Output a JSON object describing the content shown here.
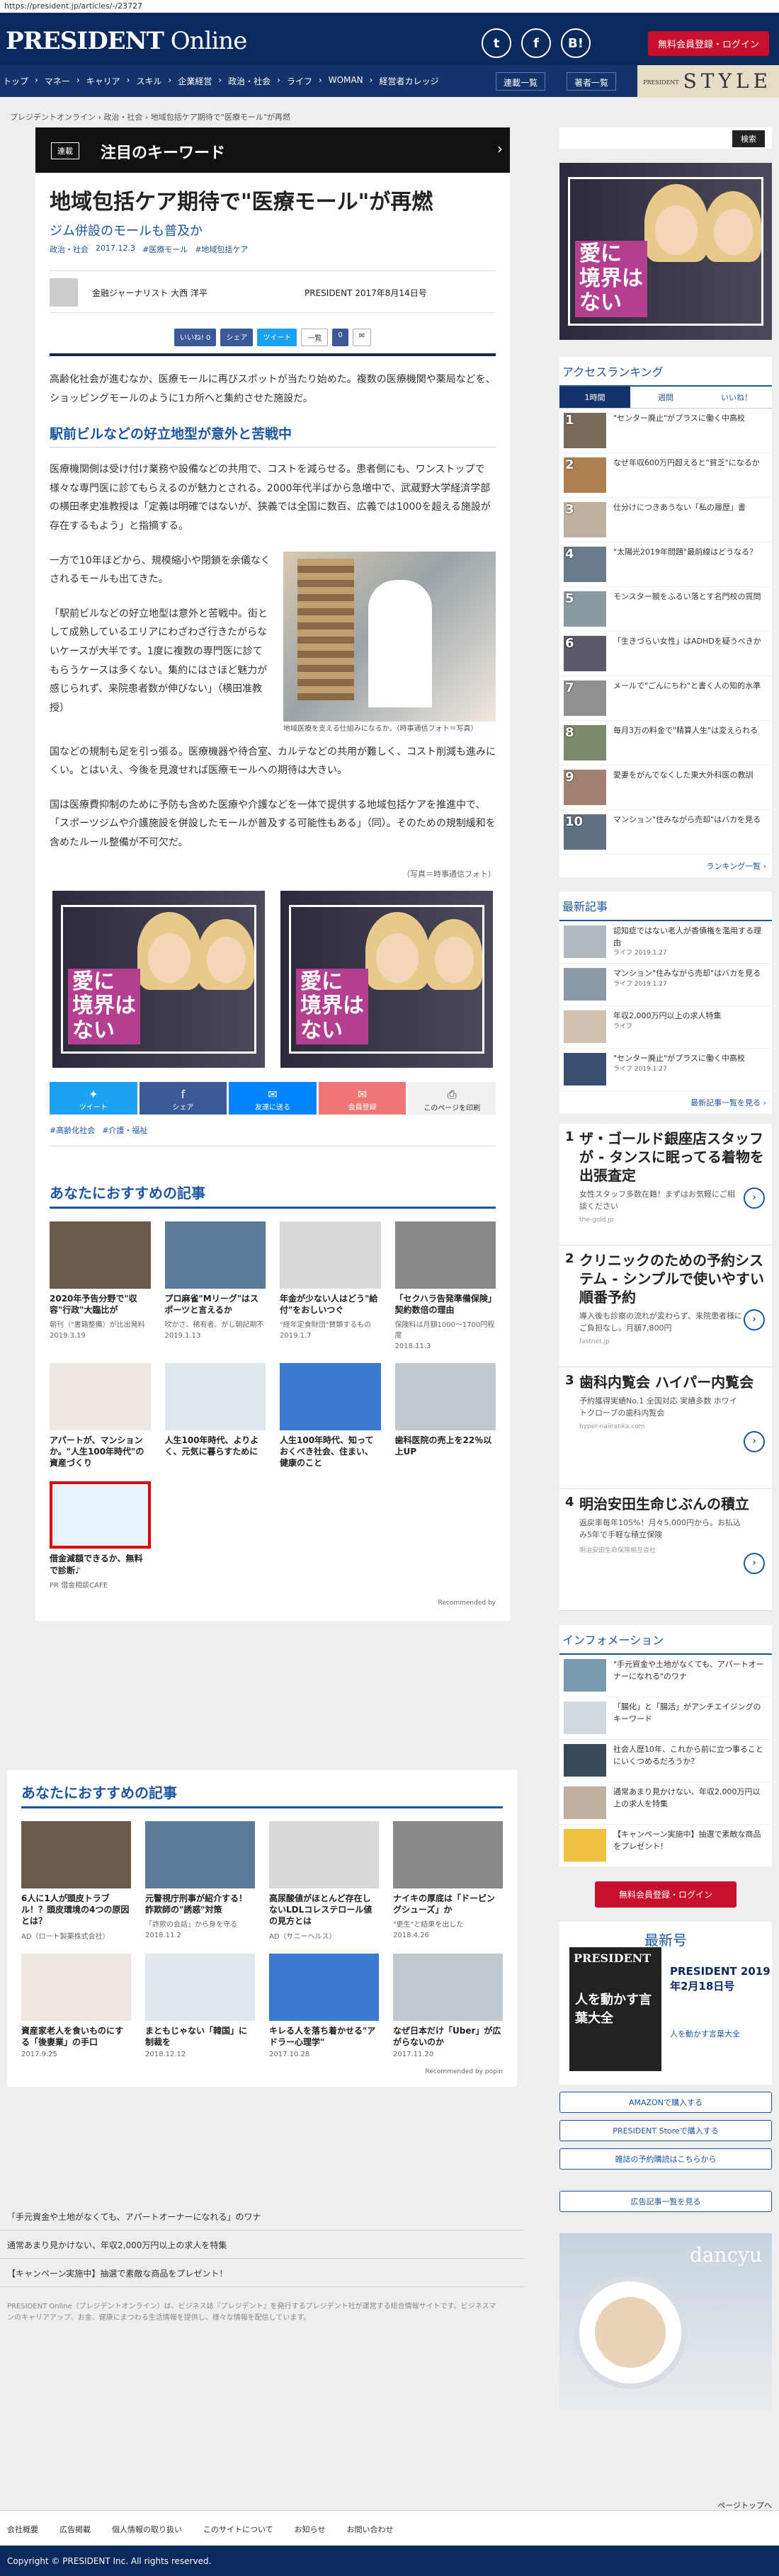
{
  "browser": {
    "url": "https://president.jp/articles/-/23727"
  },
  "header": {
    "logo_main": "PRESIDENT",
    "logo_sub": " Online",
    "social": [
      "t",
      "f",
      "B!"
    ],
    "register": "無料会員登録・ログイン"
  },
  "nav": {
    "items": [
      "トップ",
      "マネー",
      "キャリア",
      "スキル",
      "企業経営",
      "政治・社会",
      "ライフ",
      "WOMAN",
      "経営者カレッジ"
    ],
    "serial": "連載一覧",
    "authors": "著者一覧",
    "style_small": "PRESIDENT",
    "style": "STYLE"
  },
  "breadcrumb": "プレジデントオンライン  ›  政治・社会  ›  地域包括ケア期待で\"医療モール\"が再燃",
  "keyword": {
    "tag": "連載",
    "title": "注目のキーワード",
    "arrow": "›"
  },
  "article": {
    "title": "地域包括ケア期待で\"医療モール\"が再燃",
    "subtitle": "ジム併設のモールも普及か",
    "meta": [
      "政治・社会",
      "2017.12.3",
      "#医療モール",
      "#地域包括ケア"
    ],
    "author": "金融ジャーナリスト 大西 洋平",
    "source": "PRESIDENT 2017年8月14日号",
    "share": [
      "いいね! 0",
      "シェア",
      "ツイート",
      "一覧",
      "0"
    ],
    "p1": "高齢化社会が進むなか、医療モールに再びスポットが当たり始めた。複数の医療機関や薬局などを、ショッピングモールのように1カ所へと集約させた施設だ。",
    "h2": "駅前ビルなどの好立地型が意外と苦戦中",
    "p2": "医療機関側は受け付け業務や設備などの共用で、コストを減らせる。患者側にも、ワンストップで様々な専門医に診てもらえるのが魅力とされる。2000年代半ばから急増中で、武蔵野大学経済学部の横田孝史准教授は「定義は明確ではないが、狭義では全国に数百、広義では1000を超える施設が存在するもよう」と指摘する。",
    "p3": "一方で10年ほどから、規模縮小や閉鎖を余儀なくされるモールも出てきた。",
    "p4": "「駅前ビルなどの好立地型は意外と苦戦中。街として成熟しているエリアにわざわざ行きたがらないケースが大半です。1度に複数の専門医に診てもらうケースは多くない。集約にはさほど魅力が感じられず、来院患者数が伸びない」（横田准教授）",
    "p5": "国などの規制も足を引っ張る。医療機器や待合室、カルテなどの共用が難しく、コスト削減も進みにくい。とはいえ、今後を見渡せれば医療モールへの期待は大きい。",
    "p6": "国は医療費抑制のために予防も含めた医療や介護などを一体で提供する地域包括ケアを推進中で、「スポーツジムや介護施設を併設したモールが普及する可能性もある」（同）。そのための規制緩和を含めたルール整備が不可欠だ。",
    "photo_caption": "地域医療を支える仕組みになるか。（時事通信フォト＝写真）",
    "credit": "（写真＝時事通信フォト）",
    "ad_text": "愛に\n境界は\nない",
    "share_buttons": [
      "ツイート",
      "シェア",
      "友達に送る",
      "会員登録",
      "このページを印刷"
    ],
    "tags": [
      "#高齢化社会",
      "#介護・福祉"
    ]
  },
  "reco1": {
    "heading": "あなたにおすすめの記事",
    "cards": [
      {
        "t": "2020年予告分野で\"収容\"行政\"大臨比が",
        "s": "朝刊（\"書籍整備）が比出発料",
        "d": "2019.3.19"
      },
      {
        "t": "プロ麻雀\"Mリーグ\"はスポーツと言えるか",
        "s": "吹かさ、稀有者、がし朝記期不",
        "d": "2019.1.13"
      },
      {
        "t": "年金が少ない人はどう\"給付\"をおしいつぐ",
        "s": "\"経年定食財団\"賛類するもの",
        "d": "2019.1.7"
      },
      {
        "t": "「セクハラ告発準備保険」契約数倍の理由",
        "s": "保険料は月額1000～1700円程度",
        "d": "2018.11.3"
      },
      {
        "t": "アパートが、マンションか。\"人生100年時代\"の資産づくり",
        "s": "",
        "d": ""
      },
      {
        "t": "人生100年時代、よりよく、元気に暮らすために",
        "s": "",
        "d": ""
      },
      {
        "t": "人生100年時代、知っておくべき社会、住まい、健康のこと",
        "s": "",
        "d": ""
      },
      {
        "t": "歯科医院の売上を22％以上UP",
        "s": "",
        "d": ""
      },
      {
        "t": "借金減額できるか、無料で診断♪",
        "s": "PR 借金相談CAFE",
        "d": ""
      }
    ],
    "recommended": "Recommended by"
  },
  "reco2": {
    "heading": "あなたにおすすめの記事",
    "cards": [
      {
        "t": "6人に1人が頭皮トラブル！？頭皮環境の4つの原因とは？",
        "s": "AD（ロート製薬株式会社）",
        "d": ""
      },
      {
        "t": "元警視庁刑事が紹介する！ 詐欺師の\"誘惑\"対策",
        "s": "「詐欺の会話」から身を守る",
        "d": "2018.11.2"
      },
      {
        "t": "高尿酸値がほとんど存在しないLDLコレステロール値の見方とは",
        "s": "AD（サニーヘルス）",
        "d": ""
      },
      {
        "t": "ナイキの厚底は「ドーピングシューズ」か",
        "s": "\"更生\"と結果を出した",
        "d": "2018.4.26"
      },
      {
        "t": "資産家老人を食いものにする「後妻業」の手口",
        "s": "",
        "d": "2017.9.25"
      },
      {
        "t": "まともじゃない「韓国」に制裁を",
        "s": "",
        "d": "2018.12.12"
      },
      {
        "t": "キレる人を落ち着かせる\"アドラー心理学\"",
        "s": "",
        "d": "2017.10.28"
      },
      {
        "t": "なぜ日本だけ「Uber」が広がらないのか",
        "s": "",
        "d": "2017.11.20"
      }
    ],
    "popin": "Recommended by popin"
  },
  "bottom_links": [
    "「手元資金や土地がなくても、アパートオーナーになれる」のワナ",
    "通常あまり見かけない、年収2,000万円以上の求人を特集",
    "【キャンペーン実施中】抽選で素敵な商品をプレゼント！"
  ],
  "disclaimer": "PRESIDENT Online（プレジデントオンライン）は、ビジネス誌『プレジデント』を発行するプレジデント社が運営する総合情報サイトです。ビジネスマンのキャリアアップ、お金、健康にまつわる生活情報を提供し、様々な情報を配信しています。",
  "footer": {
    "links": [
      "会社概要",
      "広告掲載",
      "個人情報の取り扱い",
      "このサイトについて",
      "お知らせ",
      "お問い合わせ"
    ],
    "top": "ページトップへ",
    "copyright": "Copyright © PRESIDENT Inc. All rights reserved."
  },
  "sidebar": {
    "search": "検索",
    "ranking_title": "アクセスランキング",
    "tabs": [
      "1時間",
      "週間",
      "いいね！"
    ],
    "ranking": [
      "\"センター廃止\"がプラスに働く中高校",
      "なぜ年収600万円超えると\"貧乏\"になるか",
      "仕分けにつきあうない「私の履歴」書",
      "\"太陽光2019年問題\"最前線はどうなる？",
      "モンスター親をふるい落とす名門校の質問",
      "「生きづらい女性」はADHDを疑うべきか",
      "メールで\"ごんにちわ\"と書く人の知的水準",
      "毎月3万の料金で\"精算人生\"は変えられる",
      "愛妻をがんでなくした東大外科医の教訓",
      "マンション\"住みながら売却\"はバカを見る"
    ],
    "ranking_more": "ランキング一覧 ›",
    "latest_title": "最新記事",
    "latest": [
      {
        "t": "認知症ではない老人が香債権を濫用する理由",
        "d": "ライフ 2019.1.27"
      },
      {
        "t": "マンション\"住みながら売却\"はバカを見る",
        "d": "ライフ 2019.1.27"
      },
      {
        "t": "年収2,000万円以上の求人特集",
        "d": "ライフ"
      },
      {
        "t": "\"センター廃止\"がプラスに働く中高校",
        "d": "ライフ 2019.1.27"
      }
    ],
    "latest_more": "最新記事一覧を見る ›",
    "sponsor": [
      {
        "n": "1",
        "t": "ザ・ゴールド銀座店スタッフが - タンスに眠ってる着物を出張査定",
        "d": "女性スタッフ多数在籍！まずはお気軽にご相談ください",
        "u": "the-gold.jp"
      },
      {
        "n": "2",
        "t": "クリニックのための予約システム - シンプルで使いやすい順番予約",
        "d": "導入後も診察の流れが変わらず、来院患者様にご負担なし。月額7,800円",
        "u": "fastnet.jp"
      },
      {
        "n": "3",
        "t": "歯科内覧会 ハイパー内覧会",
        "d": "予約獲得実績No.1 全国対応 実績多数 ホワイトクローブの歯科内覧会",
        "u": "hyper-naiiranka.com"
      },
      {
        "n": "4",
        "t": "明治安田生命じぶんの積立",
        "d": "返戻率毎年105%！月々5,000円から。お払込み5年で手軽な積立保険",
        "u": "明治安田生命保険相互会社"
      }
    ],
    "info_title": "インフォメーション",
    "info": [
      "\"手元資金や土地がなくても、アパートオーナーになれる\"のワナ",
      "「腸化」と「腸活」がアンチエイジングのキーワード",
      "社会人歴10年、これから前に立つ事ることにいくつめるだろうか？",
      "通常あまり見かけない、年収2,000万円以上の求人を特集",
      "【キャンペーン実施中】抽選で素敵な商品をプレゼント！"
    ],
    "register": "無料会員登録・ログイン",
    "mag_head": "最新号",
    "mag_cover": "PRESIDENT",
    "mag_cover_copy": "人を動かす言葉大全",
    "mag_title": "PRESIDENT 2019年2月18日号",
    "mag_sub": "人を動かす言葉大全",
    "buy": [
      "AMAZONで購入する",
      "PRESIDENT Storeで購入する",
      "雑誌の予約購読はこちらから"
    ],
    "adlist": "広告記事一覧を見る",
    "dancyu": "dancyu"
  },
  "colors": {
    "navy": "#0a2a5e",
    "accent": "#1d56a0",
    "red": "#c8102e"
  }
}
